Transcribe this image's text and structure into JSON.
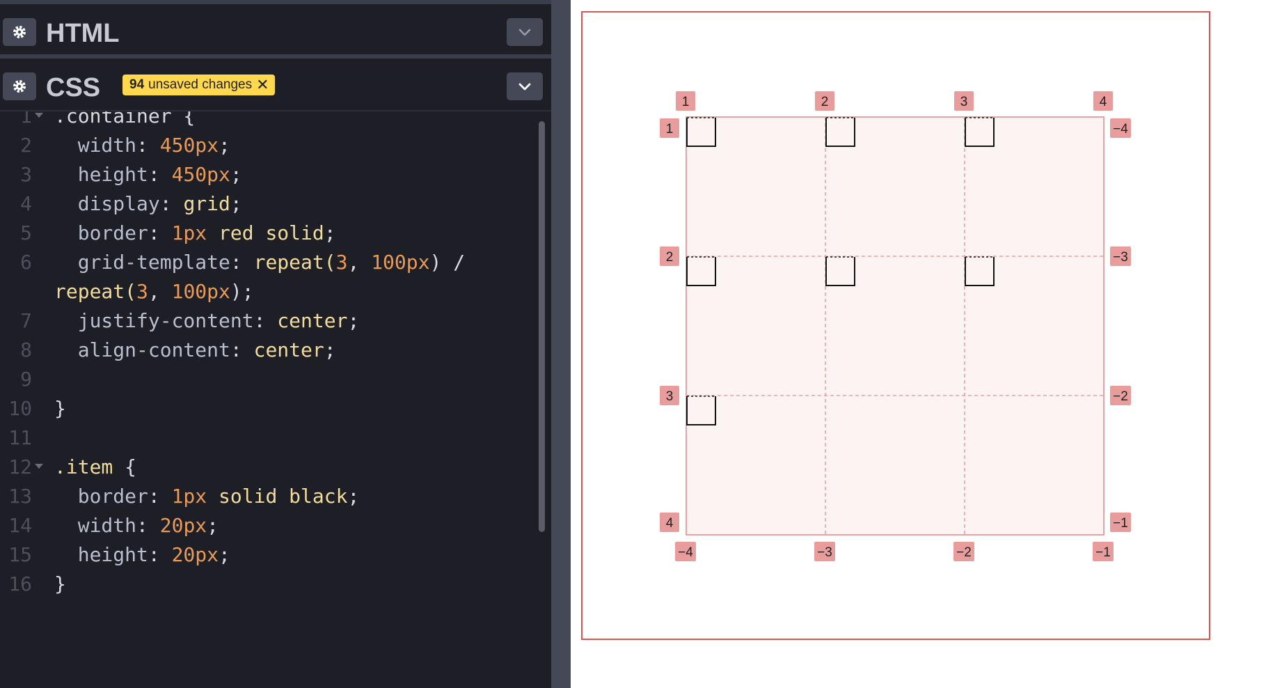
{
  "editor": {
    "html_panel": {
      "title": "HTML"
    },
    "css_panel": {
      "title": "CSS",
      "unsaved_count": "94",
      "unsaved_text": "unsaved changes",
      "unsaved_close": "✕"
    },
    "code_lines": [
      {
        "n": "1",
        "fold": true,
        "tokens": [
          {
            "t": ".container {",
            "c": "punc"
          }
        ]
      },
      {
        "n": "2",
        "tokens": [
          {
            "t": "  width",
            "c": "prop"
          },
          {
            "t": ": ",
            "c": "punc"
          },
          {
            "t": "450px",
            "c": "num"
          },
          {
            "t": ";",
            "c": "punc"
          }
        ]
      },
      {
        "n": "3",
        "tokens": [
          {
            "t": "  height",
            "c": "prop"
          },
          {
            "t": ": ",
            "c": "punc"
          },
          {
            "t": "450px",
            "c": "num"
          },
          {
            "t": ";",
            "c": "punc"
          }
        ]
      },
      {
        "n": "4",
        "tokens": [
          {
            "t": "  display",
            "c": "prop"
          },
          {
            "t": ": ",
            "c": "punc"
          },
          {
            "t": "grid",
            "c": "kw"
          },
          {
            "t": ";",
            "c": "punc"
          }
        ]
      },
      {
        "n": "5",
        "tokens": [
          {
            "t": "  border",
            "c": "prop"
          },
          {
            "t": ": ",
            "c": "punc"
          },
          {
            "t": "1px",
            "c": "num"
          },
          {
            "t": " red solid",
            "c": "kw"
          },
          {
            "t": ";",
            "c": "punc"
          }
        ]
      },
      {
        "n": "6",
        "tokens": [
          {
            "t": "  grid-template",
            "c": "prop"
          },
          {
            "t": ": ",
            "c": "punc"
          },
          {
            "t": "repeat(",
            "c": "kw"
          },
          {
            "t": "3",
            "c": "num"
          },
          {
            "t": ", ",
            "c": "punc"
          },
          {
            "t": "100px",
            "c": "num"
          },
          {
            "t": ") /",
            "c": "punc"
          }
        ]
      },
      {
        "n": "",
        "tokens": [
          {
            "t": "repeat(",
            "c": "kw"
          },
          {
            "t": "3",
            "c": "num"
          },
          {
            "t": ", ",
            "c": "punc"
          },
          {
            "t": "100px",
            "c": "num"
          },
          {
            "t": ");",
            "c": "punc"
          }
        ]
      },
      {
        "n": "7",
        "tokens": [
          {
            "t": "  justify-content",
            "c": "prop"
          },
          {
            "t": ": ",
            "c": "punc"
          },
          {
            "t": "center",
            "c": "kw"
          },
          {
            "t": ";",
            "c": "punc"
          }
        ]
      },
      {
        "n": "8",
        "tokens": [
          {
            "t": "  align-content",
            "c": "prop"
          },
          {
            "t": ": ",
            "c": "punc"
          },
          {
            "t": "center",
            "c": "kw"
          },
          {
            "t": ";",
            "c": "punc"
          }
        ]
      },
      {
        "n": "9",
        "tokens": []
      },
      {
        "n": "10",
        "tokens": [
          {
            "t": "}",
            "c": "punc"
          }
        ]
      },
      {
        "n": "11",
        "tokens": []
      },
      {
        "n": "12",
        "fold": true,
        "tokens": [
          {
            "t": ".item",
            "c": "kw"
          },
          {
            "t": " {",
            "c": "punc"
          }
        ]
      },
      {
        "n": "13",
        "tokens": [
          {
            "t": "  border",
            "c": "prop"
          },
          {
            "t": ": ",
            "c": "punc"
          },
          {
            "t": "1px",
            "c": "num"
          },
          {
            "t": " solid black",
            "c": "kw"
          },
          {
            "t": ";",
            "c": "punc"
          }
        ]
      },
      {
        "n": "14",
        "tokens": [
          {
            "t": "  width",
            "c": "prop"
          },
          {
            "t": ": ",
            "c": "punc"
          },
          {
            "t": "20px",
            "c": "num"
          },
          {
            "t": ";",
            "c": "punc"
          }
        ]
      },
      {
        "n": "15",
        "tokens": [
          {
            "t": "  height",
            "c": "prop"
          },
          {
            "t": ": ",
            "c": "punc"
          },
          {
            "t": "20px",
            "c": "num"
          },
          {
            "t": ";",
            "c": "punc"
          }
        ]
      },
      {
        "n": "16",
        "tokens": [
          {
            "t": "}",
            "c": "punc"
          }
        ]
      }
    ]
  },
  "preview": {
    "grid": {
      "rows": 3,
      "cols": 3,
      "items": 7
    },
    "top_line_labels": [
      "1",
      "2",
      "3",
      "4"
    ],
    "bottom_line_labels": [
      "-4",
      "-3",
      "-2",
      "-1"
    ],
    "left_line_labels": [
      "1",
      "2",
      "3",
      "4"
    ],
    "right_line_labels": [
      "-4",
      "-3",
      "-2",
      "-1"
    ],
    "colors": {
      "container_border": "#d9534f",
      "grid_fill": "#fcf3f3",
      "grid_line": "#e8a3a3",
      "badge_fill": "#e89c9c",
      "item_border": "#111111"
    }
  }
}
